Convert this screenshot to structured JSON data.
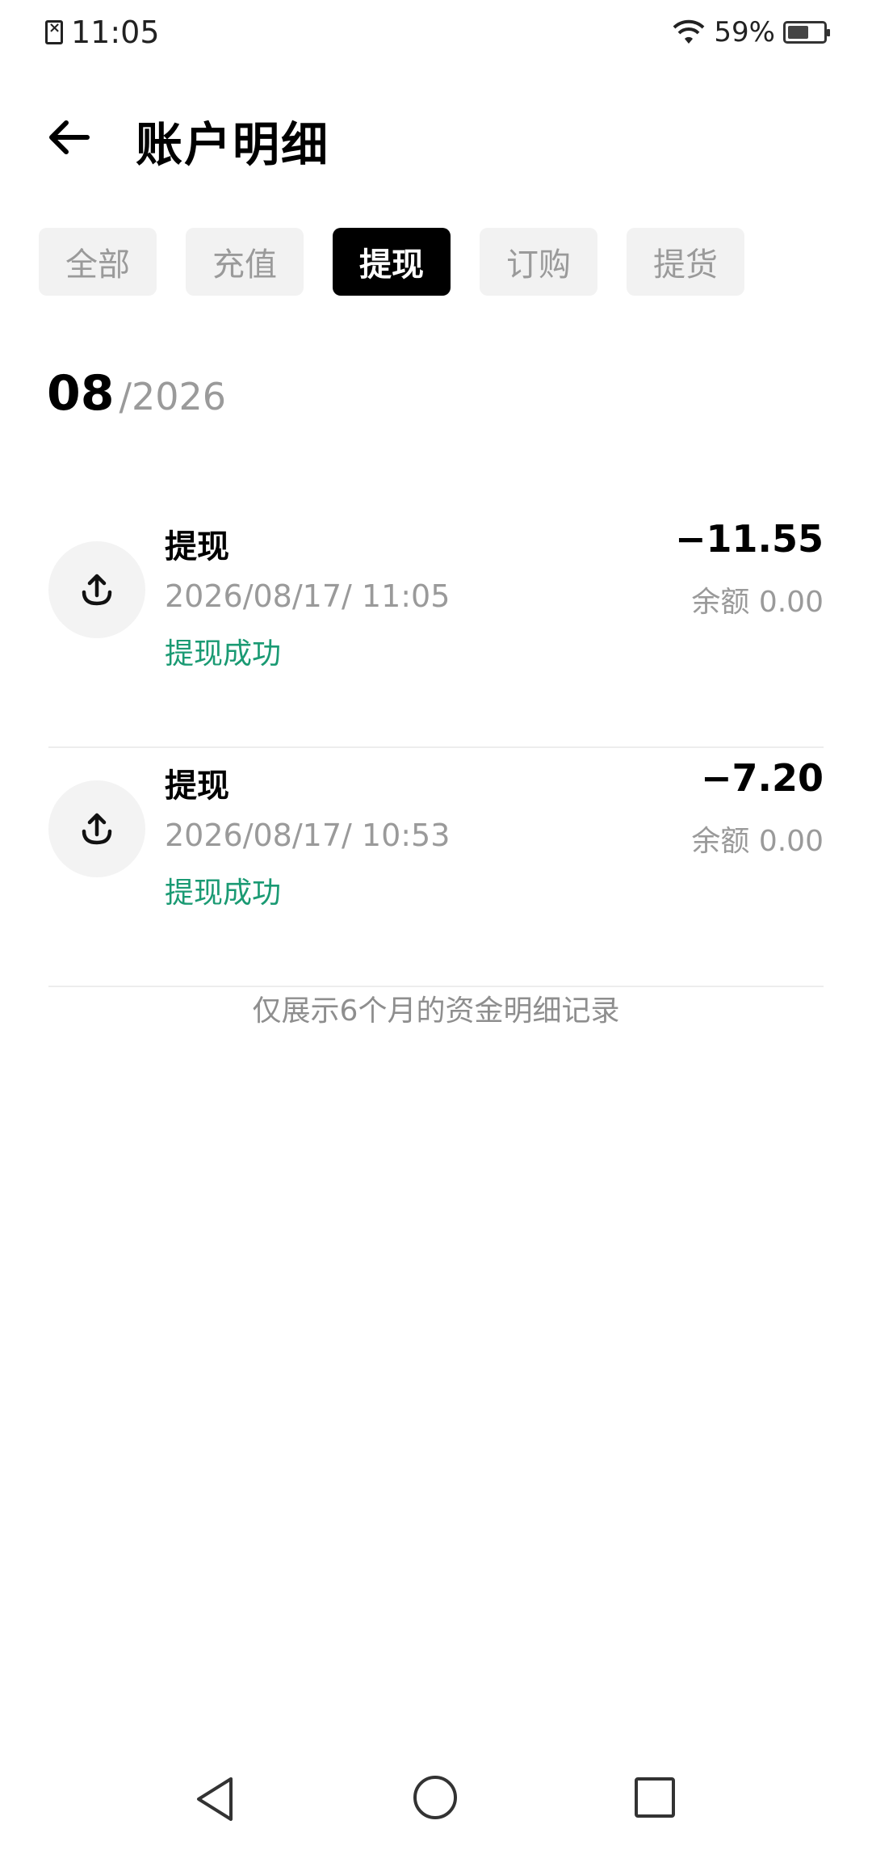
{
  "status_bar": {
    "time": "11:05",
    "battery_text": "59%",
    "battery_level": 0.59,
    "icons": [
      "sim-error-icon",
      "wifi-icon",
      "battery-icon"
    ]
  },
  "header": {
    "title": "账户明细",
    "back_icon": "arrow-left-icon"
  },
  "tabs": [
    {
      "label": "全部",
      "active": false
    },
    {
      "label": "充值",
      "active": false
    },
    {
      "label": "提现",
      "active": true
    },
    {
      "label": "订购",
      "active": false
    },
    {
      "label": "提货",
      "active": false
    }
  ],
  "month_header": {
    "month": "08",
    "year": "/2026"
  },
  "records": [
    {
      "icon": "upload-icon",
      "type": "提现",
      "time": "2026/08/17/ 11:05",
      "status": "提现成功",
      "amount": "−11.55",
      "balance": "余额 0.00"
    },
    {
      "icon": "upload-icon",
      "type": "提现",
      "time": "2026/08/17/ 10:53",
      "status": "提现成功",
      "amount": "−7.20",
      "balance": "余额 0.00"
    }
  ],
  "footer_note": "仅展示6个月的资金明细记录",
  "colors": {
    "success": "#1a9a73",
    "muted": "#9a9a9a",
    "active_tab_bg": "#000000",
    "tab_bg": "#f2f2f2"
  },
  "nav_bar": {
    "icons": [
      "nav-back-icon",
      "nav-home-icon",
      "nav-recents-icon"
    ]
  }
}
